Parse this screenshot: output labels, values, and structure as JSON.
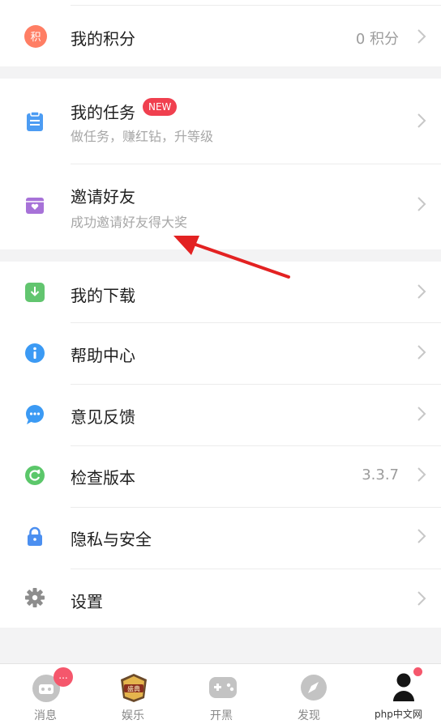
{
  "points": {
    "label": "我的积分",
    "value": "0 积分",
    "icon_text": "积"
  },
  "tasks": {
    "title": "我的任务",
    "badge": "NEW",
    "subtitle": "做任务，赚红钻，升等级"
  },
  "invite": {
    "title": "邀请好友",
    "subtitle": "成功邀请好友得大奖"
  },
  "menu": {
    "download": "我的下载",
    "help": "帮助中心",
    "feedback": "意见反馈",
    "version": {
      "label": "检查版本",
      "value": "3.3.7"
    },
    "privacy": "隐私与安全",
    "settings": "设置"
  },
  "tabs": [
    {
      "label": "消息",
      "badge": "..."
    },
    {
      "label": "娱乐",
      "icon_text": "盛典"
    },
    {
      "label": "开黑"
    },
    {
      "label": "发现"
    },
    {
      "label": ""
    }
  ],
  "watermark": "php中文网",
  "colors": {
    "points_icon": "#ff7e64",
    "tasks_icon": "#4c9cf3",
    "invite_icon": "#a772d8",
    "download_icon": "#62c56f",
    "help_icon": "#3b9af4",
    "feedback_icon": "#3b9af4",
    "version_icon": "#5bc76a",
    "privacy_icon": "#4b8ff0",
    "settings_icon": "#8d8d8d",
    "badge_red": "#f0404f",
    "arrow_red": "#e32222"
  }
}
